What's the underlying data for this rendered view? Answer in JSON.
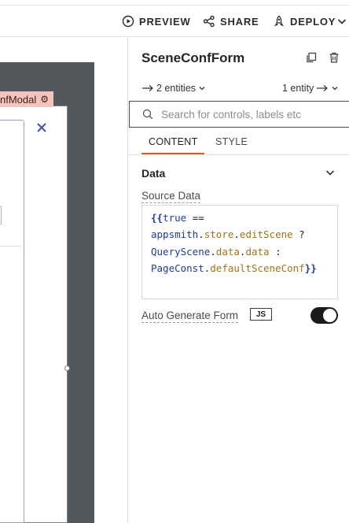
{
  "topbar": {
    "preview_label": "PREVIEW",
    "share_label": "SHARE",
    "deploy_label": "DEPLOY"
  },
  "canvas": {
    "modal_label": "nfModal"
  },
  "pane": {
    "title": "SceneConfForm",
    "entities_in": "2 entities",
    "entities_out": "1 entity",
    "search_placeholder": "Search for controls, labels etc",
    "tabs": [
      {
        "label": "CONTENT",
        "active": true
      },
      {
        "label": "STYLE",
        "active": false
      }
    ],
    "section": {
      "title": "Data",
      "source_label": "Source Data",
      "source_code": {
        "open_brace": "{{",
        "close_brace": "}}",
        "t_true": "true",
        "t_eq": " ==",
        "t_appsmith": "appsmith",
        "t_store": "store",
        "t_editScene": "editScene",
        "t_q": " ?",
        "t_QueryScene": "QueryScene",
        "t_data1": "data",
        "t_data2": "data",
        "t_colon": " :",
        "t_PageConst": "PageConst",
        "t_defaultSceneConf": "defaultSceneConf",
        "t_dot": "."
      },
      "auto_label": "Auto Generate Form",
      "js_badge": "JS",
      "auto_enabled": true
    }
  },
  "colors": {
    "accent": "#e15a2a",
    "modal_tag": "#f6c3bd",
    "canvas_dark": "#53585d",
    "code_blue": "#1f3a93",
    "code_prop": "#a07418"
  }
}
